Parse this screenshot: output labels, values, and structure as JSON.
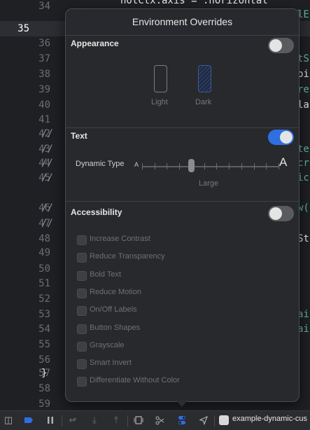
{
  "editor": {
    "line_numbers": [
      "34",
      "35",
      "36",
      "37",
      "38",
      "39",
      "40",
      "41",
      "42",
      "43",
      "44",
      "45",
      "46",
      "47",
      "48",
      "49",
      "50",
      "51",
      "52",
      "53",
      "54",
      "55",
      "56",
      "57",
      "58",
      "59"
    ],
    "current_line": "35",
    "fragments": {
      "l34": "hotCtx.axis = .horizontal",
      "l34_right": "lE",
      "l37_right": "tS",
      "l38_right": "pi",
      "l39_right": "re",
      "l40_right": "la",
      "comment": "//",
      "l43_right": "te",
      "l44_right": "cr",
      "l45_right": "ic",
      "l46_right": "w(",
      "l48_right": "St",
      "l53_right": "ai",
      "l54_right": "ai",
      "brace": "}"
    }
  },
  "popover": {
    "title": "Environment Overrides",
    "appearance": {
      "label": "Appearance",
      "enabled": false,
      "light_label": "Light",
      "dark_label": "Dark",
      "selected": "Dark"
    },
    "text": {
      "label": "Text",
      "enabled": true,
      "dynamic_type_label": "Dynamic Type",
      "small_a": "A",
      "big_a": "A",
      "size_value": "Large",
      "slider_position": 0.36
    },
    "accessibility": {
      "label": "Accessibility",
      "enabled": false,
      "options": [
        "Increase Contrast",
        "Reduce Transparency",
        "Bold Text",
        "Reduce Motion",
        "On/Off Labels",
        "Button Shapes",
        "Grayscale",
        "Smart Invert",
        "Differentiate Without Color"
      ]
    }
  },
  "toolbar": {
    "scheme_label": "example-dynamic-cus",
    "accent": "#2f6fe0"
  }
}
